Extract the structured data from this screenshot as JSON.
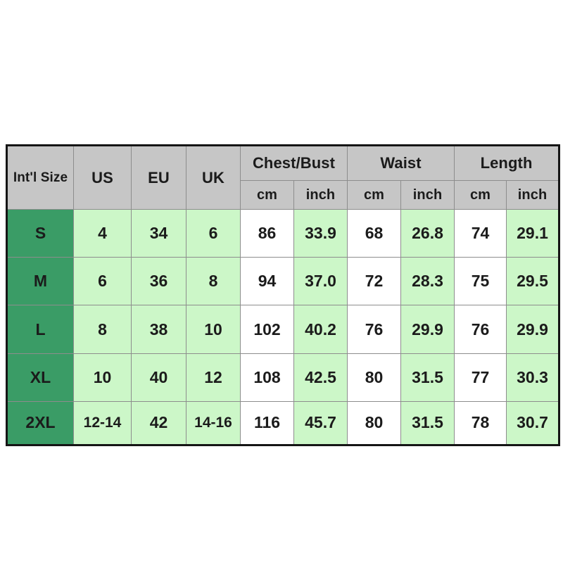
{
  "table": {
    "header": {
      "intl_size": "Int'l Size",
      "us": "US",
      "eu": "EU",
      "uk": "UK",
      "groups": [
        {
          "label": "Chest/Bust",
          "units": [
            "cm",
            "inch"
          ]
        },
        {
          "label": "Waist",
          "units": [
            "cm",
            "inch"
          ]
        },
        {
          "label": "Length",
          "units": [
            "cm",
            "inch"
          ]
        }
      ]
    },
    "rows": [
      {
        "size": "S",
        "us": "4",
        "eu": "34",
        "uk": "6",
        "chest_cm": "86",
        "chest_inch": "33.9",
        "waist_cm": "68",
        "waist_inch": "26.8",
        "length_cm": "74",
        "length_inch": "29.1"
      },
      {
        "size": "M",
        "us": "6",
        "eu": "36",
        "uk": "8",
        "chest_cm": "94",
        "chest_inch": "37.0",
        "waist_cm": "72",
        "waist_inch": "28.3",
        "length_cm": "75",
        "length_inch": "29.5"
      },
      {
        "size": "L",
        "us": "8",
        "eu": "38",
        "uk": "10",
        "chest_cm": "102",
        "chest_inch": "40.2",
        "waist_cm": "76",
        "waist_inch": "29.9",
        "length_cm": "76",
        "length_inch": "29.9"
      },
      {
        "size": "XL",
        "us": "10",
        "eu": "40",
        "uk": "12",
        "chest_cm": "108",
        "chest_inch": "42.5",
        "waist_cm": "80",
        "waist_inch": "31.5",
        "length_cm": "77",
        "length_inch": "30.3"
      },
      {
        "size": "2XL",
        "us": "12-14",
        "eu": "42",
        "uk": "14-16",
        "chest_cm": "116",
        "chest_inch": "45.7",
        "waist_cm": "80",
        "waist_inch": "31.5",
        "length_cm": "78",
        "length_inch": "30.7"
      }
    ]
  },
  "colors": {
    "size_column": "#3a9c66",
    "accent_light": "#ccf7c8",
    "header_gray": "#c6c6c6",
    "border_dark": "#151515",
    "text": "#1b1b1b"
  }
}
